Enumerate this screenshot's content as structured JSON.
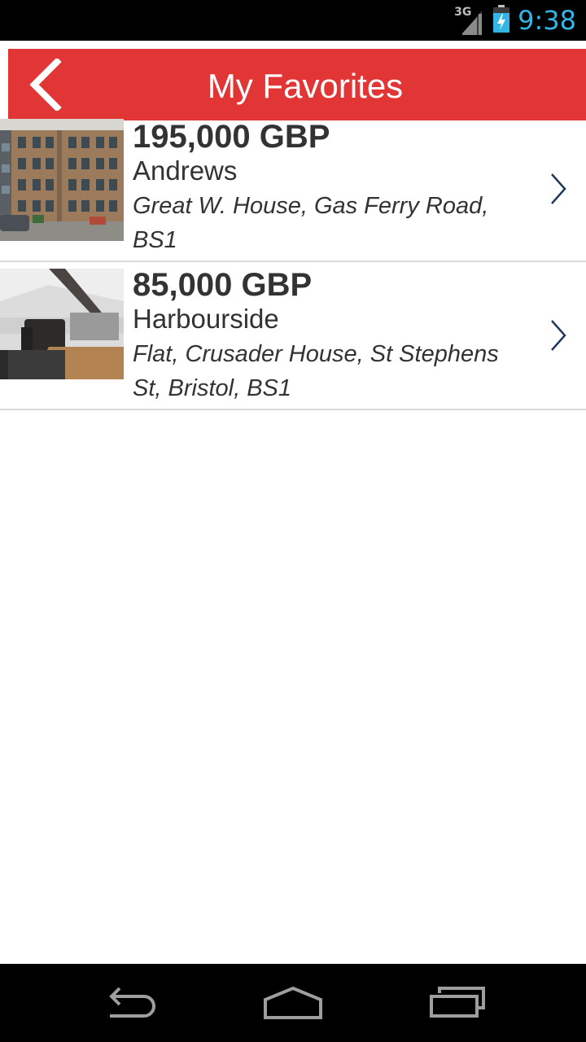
{
  "status_bar": {
    "network": "3G",
    "time": "9:38",
    "icons": [
      "signal-icon",
      "battery-charging-icon"
    ]
  },
  "header": {
    "title": "My Favorites",
    "back_icon": "chevron-left-icon"
  },
  "favorites": [
    {
      "price": "195,000 GBP",
      "area": "Andrews",
      "address": "Great W. House, Gas Ferry Road, BS1"
    },
    {
      "price": "85,000 GBP",
      "area": "Harbourside",
      "address": "Flat, Crusader House, St Stephens St, Bristol, BS1"
    }
  ],
  "nav_bar": {
    "icons": [
      "back-icon",
      "home-icon",
      "recent-apps-icon"
    ]
  },
  "colors": {
    "accent": "#e23636",
    "clock": "#33b5e5",
    "text": "#333333",
    "chevron": "#1f3a5a"
  }
}
